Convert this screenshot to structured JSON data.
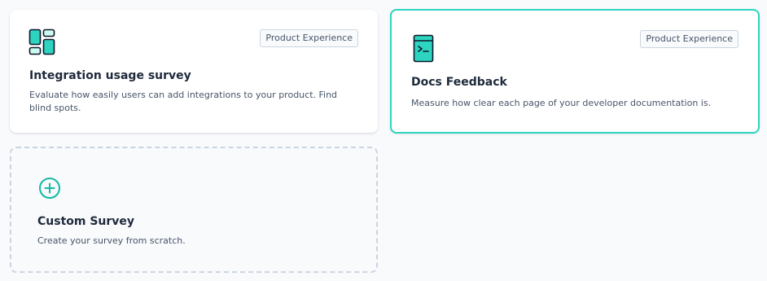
{
  "templates": [
    {
      "title": "Integration usage survey",
      "description": "Evaluate how easily users can add integrations to your product. Find blind spots.",
      "category": "Product Experience",
      "icon": "dashboard-grid-icon"
    },
    {
      "title": "Docs Feedback",
      "description": "Measure how clear each page of your developer documentation is.",
      "category": "Product Experience",
      "icon": "terminal-book-icon",
      "selected": true
    }
  ],
  "custom": {
    "title": "Custom Survey",
    "description": "Create your survey from scratch.",
    "icon": "plus-circle-icon"
  },
  "colors": {
    "accent": "#2dd4bf",
    "accent_dark": "#0f766e",
    "border": "#cbd5e1"
  }
}
